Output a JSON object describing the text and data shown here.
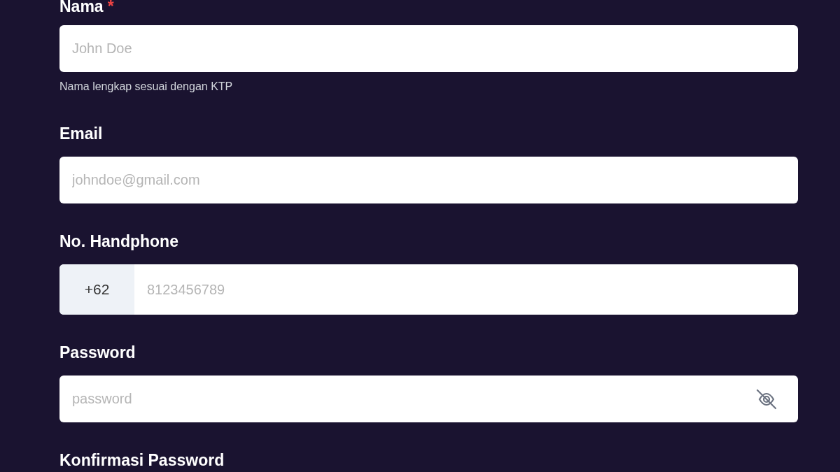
{
  "fields": [
    {
      "kind": "text",
      "label": "Nama",
      "required_mark": "*",
      "placeholder": "John Doe",
      "hint": "Nama lengkap sesuai dengan KTP"
    },
    {
      "kind": "text",
      "label": "Email",
      "placeholder": "johndoe@gmail.com"
    },
    {
      "kind": "phone",
      "label": "No. Handphone",
      "prefix": "+62",
      "placeholder": "8123456789"
    },
    {
      "kind": "password",
      "label": "Password",
      "placeholder": "password",
      "revealed": false
    },
    {
      "kind": "label",
      "label": "Konfirmasi Password"
    }
  ]
}
